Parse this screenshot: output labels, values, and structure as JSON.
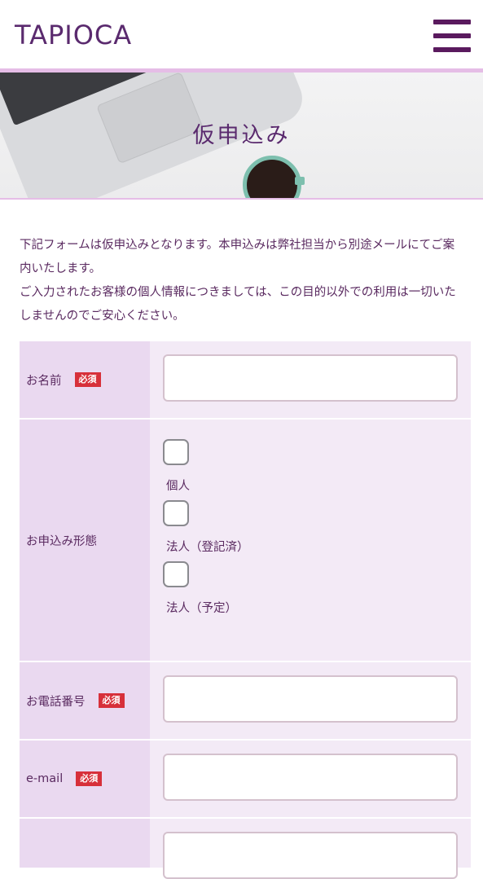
{
  "header": {
    "logo": "TAPIOCA",
    "menu_icon": "hamburger-menu-icon"
  },
  "hero": {
    "title": "仮申込み"
  },
  "intro": {
    "line1": "下記フォームは仮申込みとなります。本申込みは弊社担当から別途メールにてご案内いたします。",
    "line2": "ご入力されたお客様の個人情報につきましては、この目的以外での利用は一切いたしませんのでご安心ください。"
  },
  "form": {
    "required_badge": "必須",
    "name": {
      "label": "お名前",
      "value": ""
    },
    "type": {
      "label": "お申込み形態",
      "options": [
        "個人",
        "法人（登記済）",
        "法人（予定）"
      ]
    },
    "phone": {
      "label": "お電話番号",
      "value": ""
    },
    "email": {
      "label": "e-mail",
      "value": ""
    }
  },
  "colors": {
    "accent": "#5a2a6e",
    "label_bg": "#ead9f0",
    "field_bg": "#f3eaf6",
    "required": "#d7303a"
  }
}
